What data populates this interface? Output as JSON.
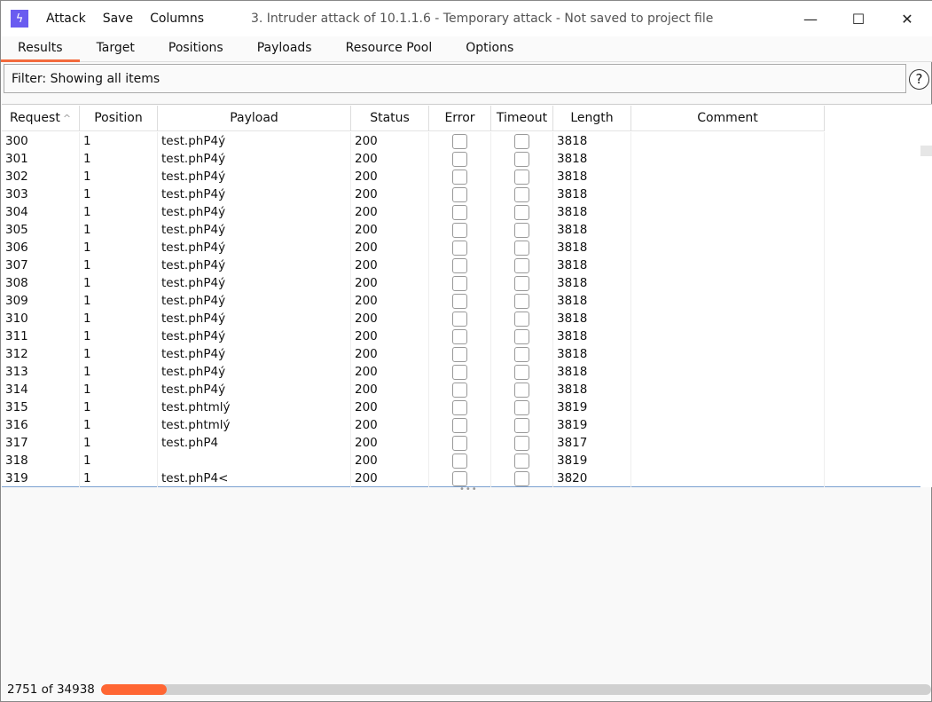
{
  "window": {
    "title": "3. Intruder attack of 10.1.1.6 - Temporary attack - Not saved to project file",
    "minimize": "—",
    "maximize": "☐",
    "close": "✕"
  },
  "menu": [
    "Attack",
    "Save",
    "Columns"
  ],
  "tabs": [
    {
      "label": "Results",
      "active": true
    },
    {
      "label": "Target"
    },
    {
      "label": "Positions"
    },
    {
      "label": "Payloads"
    },
    {
      "label": "Resource Pool"
    },
    {
      "label": "Options"
    }
  ],
  "filter": {
    "text": "Filter: Showing all items",
    "help": "?"
  },
  "table": {
    "columns": [
      "Request",
      "Position",
      "Payload",
      "Status",
      "Error",
      "Timeout",
      "Length",
      "Comment"
    ],
    "sort_indicator": "^",
    "rows": [
      [
        "300",
        "1",
        "test.phP4ý",
        "200",
        false,
        false,
        "3818",
        ""
      ],
      [
        "301",
        "1",
        "test.phP4ý",
        "200",
        false,
        false,
        "3818",
        ""
      ],
      [
        "302",
        "1",
        "test.phP4ý",
        "200",
        false,
        false,
        "3818",
        ""
      ],
      [
        "303",
        "1",
        "test.phP4ý",
        "200",
        false,
        false,
        "3818",
        ""
      ],
      [
        "304",
        "1",
        "test.phP4ý",
        "200",
        false,
        false,
        "3818",
        ""
      ],
      [
        "305",
        "1",
        "test.phP4ý",
        "200",
        false,
        false,
        "3818",
        ""
      ],
      [
        "306",
        "1",
        "test.phP4ý",
        "200",
        false,
        false,
        "3818",
        ""
      ],
      [
        "307",
        "1",
        "test.phP4ý",
        "200",
        false,
        false,
        "3818",
        ""
      ],
      [
        "308",
        "1",
        "test.phP4ý",
        "200",
        false,
        false,
        "3818",
        ""
      ],
      [
        "309",
        "1",
        "test.phP4ý",
        "200",
        false,
        false,
        "3818",
        ""
      ],
      [
        "310",
        "1",
        "test.phP4ý",
        "200",
        false,
        false,
        "3818",
        ""
      ],
      [
        "311",
        "1",
        "test.phP4ý",
        "200",
        false,
        false,
        "3818",
        ""
      ],
      [
        "312",
        "1",
        "test.phP4ý",
        "200",
        false,
        false,
        "3818",
        ""
      ],
      [
        "313",
        "1",
        "test.phP4ý",
        "200",
        false,
        false,
        "3818",
        ""
      ],
      [
        "314",
        "1",
        "test.phP4ý",
        "200",
        false,
        false,
        "3818",
        ""
      ],
      [
        "315",
        "1",
        "test.phtmlý",
        "200",
        false,
        false,
        "3819",
        ""
      ],
      [
        "316",
        "1",
        "test.phtmlý",
        "200",
        false,
        false,
        "3819",
        ""
      ],
      [
        "317",
        "1",
        "test.phP4",
        "200",
        false,
        false,
        "3817",
        ""
      ],
      [
        "318",
        "1",
        "",
        "200",
        false,
        false,
        "3819",
        ""
      ],
      [
        "319",
        "1",
        "test.phP4<",
        "200",
        false,
        false,
        "3820",
        ""
      ]
    ]
  },
  "progress": {
    "text": "2751 of 34938",
    "done": 2751,
    "total": 34938,
    "color": "#ff6633"
  },
  "accent": "#6a5cf0"
}
